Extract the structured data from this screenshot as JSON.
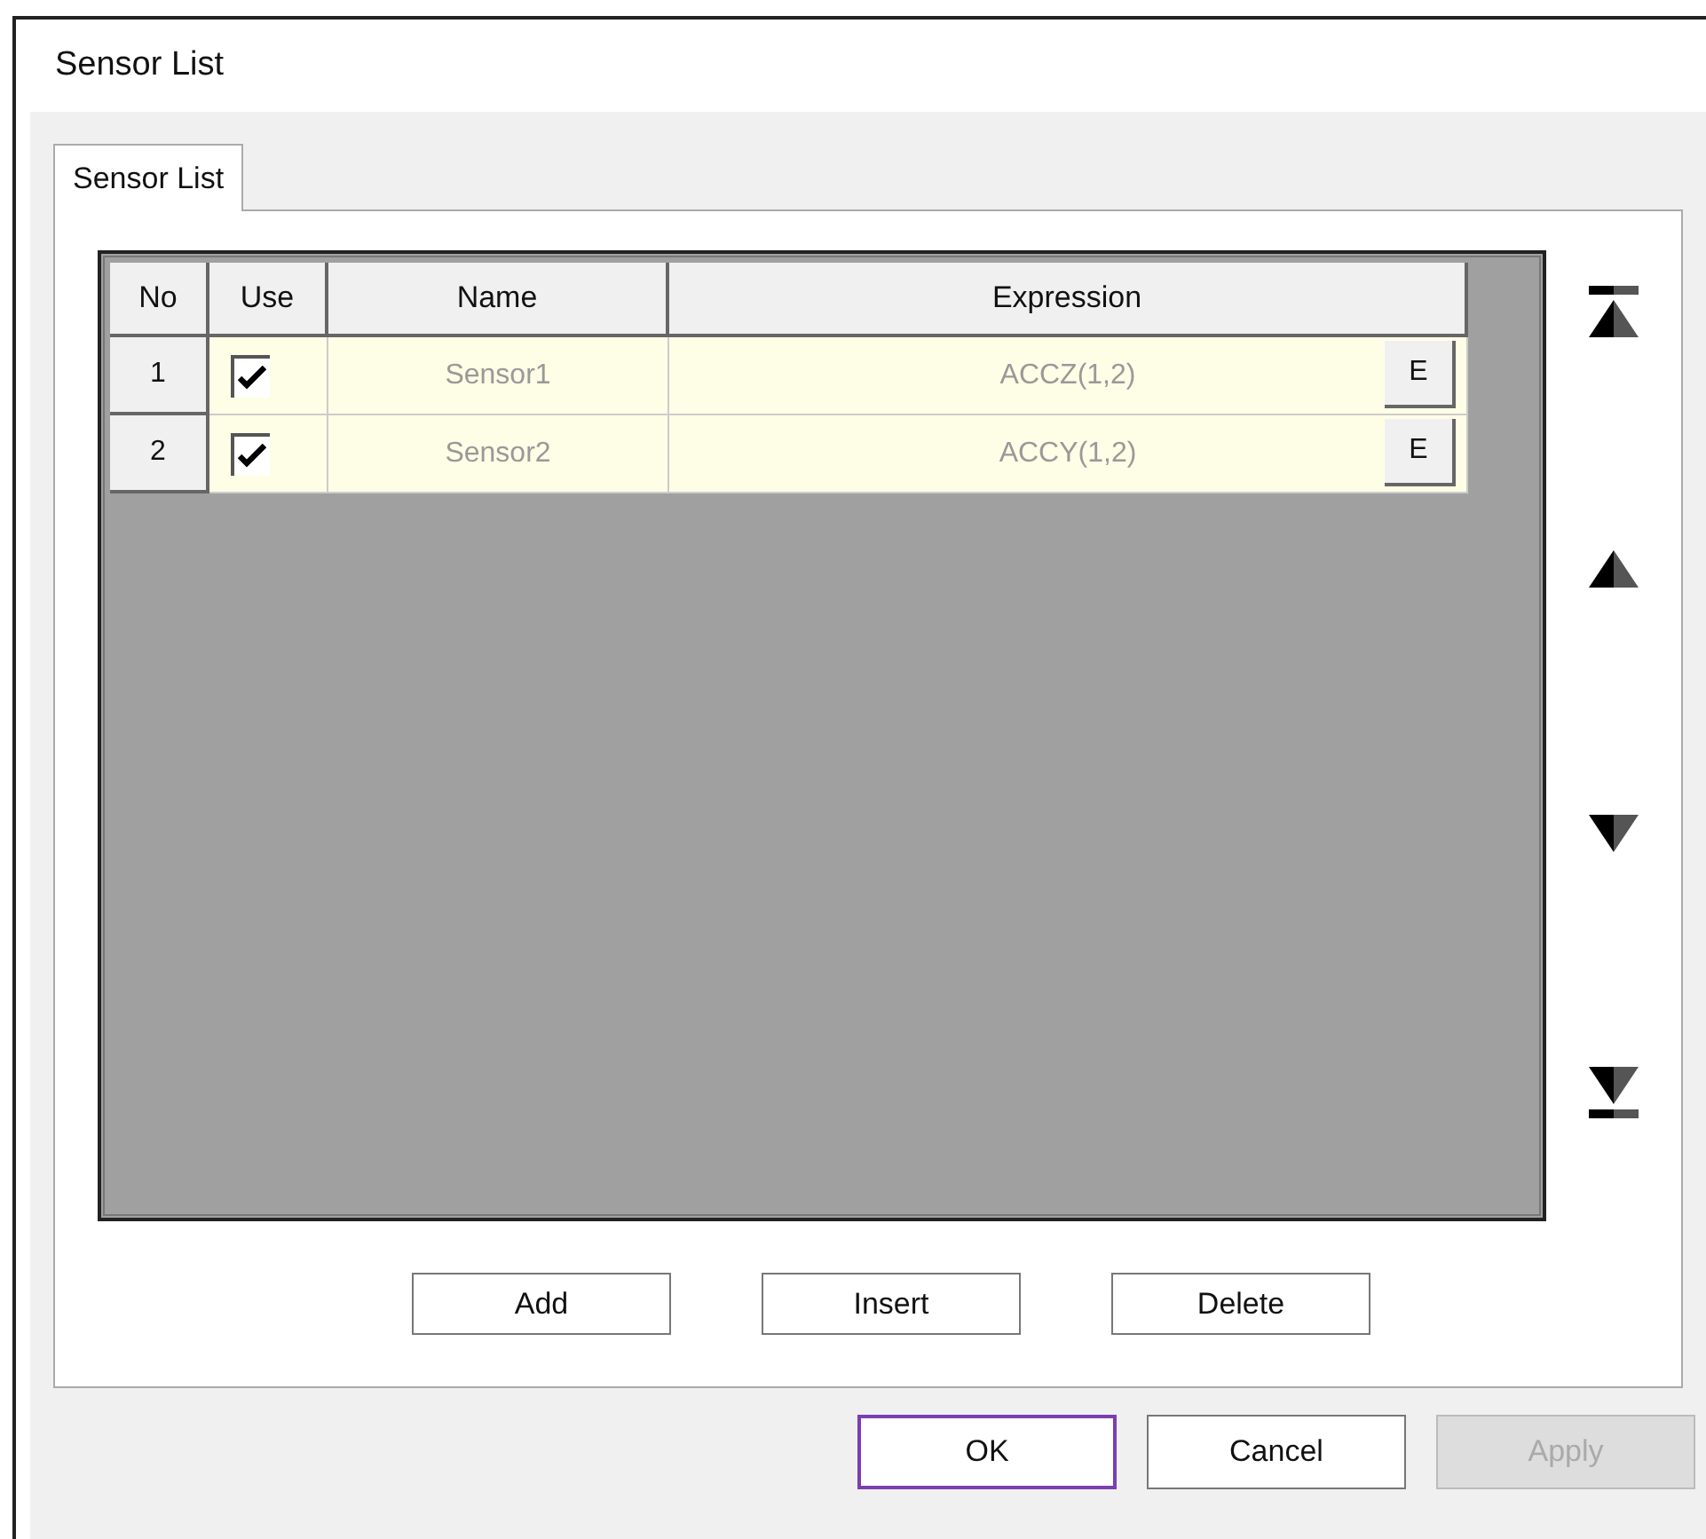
{
  "window": {
    "title": "Sensor List"
  },
  "tabs": [
    {
      "label": "Sensor List",
      "selected": true
    }
  ],
  "table": {
    "columns": [
      "No",
      "Use",
      "Name",
      "Expression"
    ],
    "rows": [
      {
        "no": "1",
        "use": true,
        "name": "Sensor1",
        "expression": "ACCZ(1,2)",
        "edit_button": "E"
      },
      {
        "no": "2",
        "use": true,
        "name": "Sensor2",
        "expression": "ACCY(1,2)",
        "edit_button": "E"
      }
    ]
  },
  "list_buttons": [
    "Add",
    "Insert",
    "Delete"
  ],
  "dialog_buttons": [
    {
      "label": "OK",
      "focused": true,
      "disabled": false
    },
    {
      "label": "Cancel",
      "focused": false,
      "disabled": false
    },
    {
      "label": "Apply",
      "focused": false,
      "disabled": true
    }
  ]
}
